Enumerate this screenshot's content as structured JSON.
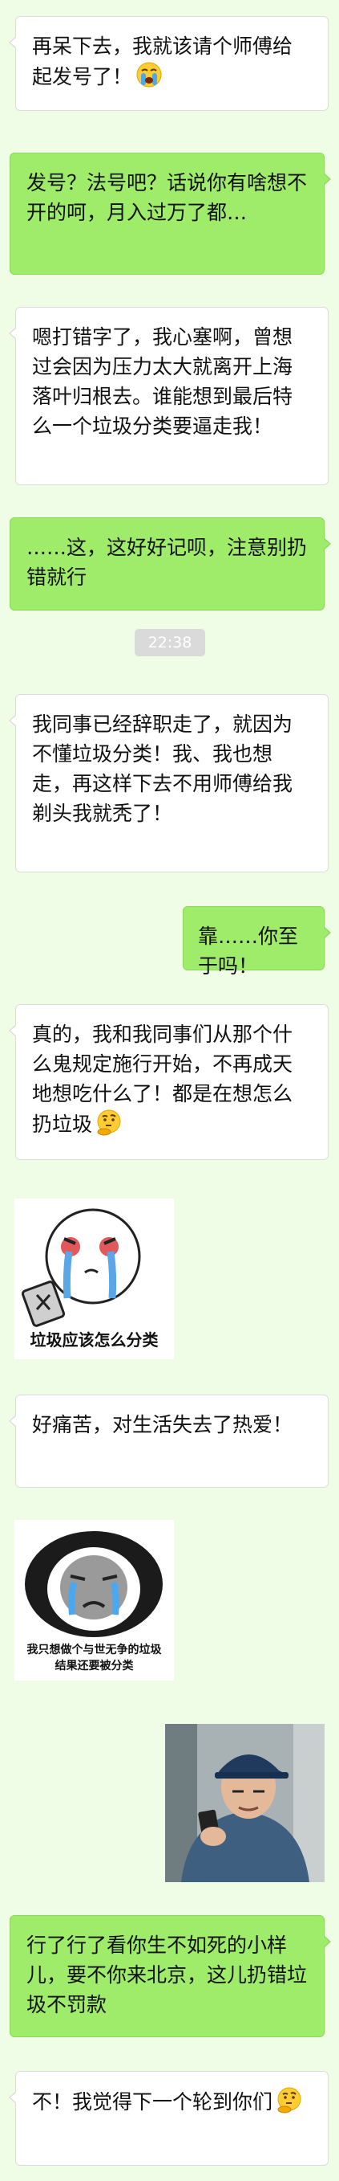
{
  "messages": [
    {
      "side": "left",
      "text": "再呆下去，我就该请个师傅给起发号了！",
      "emoji": "crying-face"
    },
    {
      "side": "right",
      "text": "发号？法号吧？话说你有啥想不开的呵，月入过万了都…"
    },
    {
      "side": "left",
      "text": "嗯打错字了，我心塞啊，曾想过会因为压力太大就离开上海落叶归根去。谁能想到最后特么一个垃圾分类要逼走我！"
    },
    {
      "side": "right",
      "text": "……这，这好好记呗，注意别扔错就行"
    },
    {
      "side": "left",
      "text": "我同事已经辞职走了，就因为不懂垃圾分类！我、我也想走，再这样下去不用师傅给我剃头我就秃了！"
    },
    {
      "side": "right",
      "text": "靠……你至于吗！"
    },
    {
      "side": "left",
      "text": "真的，我和我同事们从那个什么鬼规定施行开始，不再成天地想吃什么了！都是在想怎么扔垃圾",
      "emoji": "thinking-face"
    },
    {
      "side": "left",
      "text": "好痛苦，对生活失去了热爱！"
    },
    {
      "side": "right",
      "text": "行了行了看你生不如死的小样儿，要不你来北京，这儿扔错垃圾不罚款"
    },
    {
      "side": "left",
      "text": "不！我觉得下一个轮到你们",
      "emoji": "thinking-face"
    }
  ],
  "timestamp": "22:38",
  "stickers": [
    {
      "name": "crying-meme-sticker",
      "caption": "垃圾应该怎么分类"
    },
    {
      "name": "panda-meme-sticker",
      "caption_line1": "我只想做个与世无争的垃圾",
      "caption_line2": "结果还要被分类"
    }
  ],
  "photo": {
    "name": "elderly-man-phone-photo"
  },
  "colors": {
    "background": "#f0fde6",
    "bubble_left": "#ffffff",
    "bubble_right": "#9feb6a",
    "timestamp_bg": "#dadada"
  }
}
